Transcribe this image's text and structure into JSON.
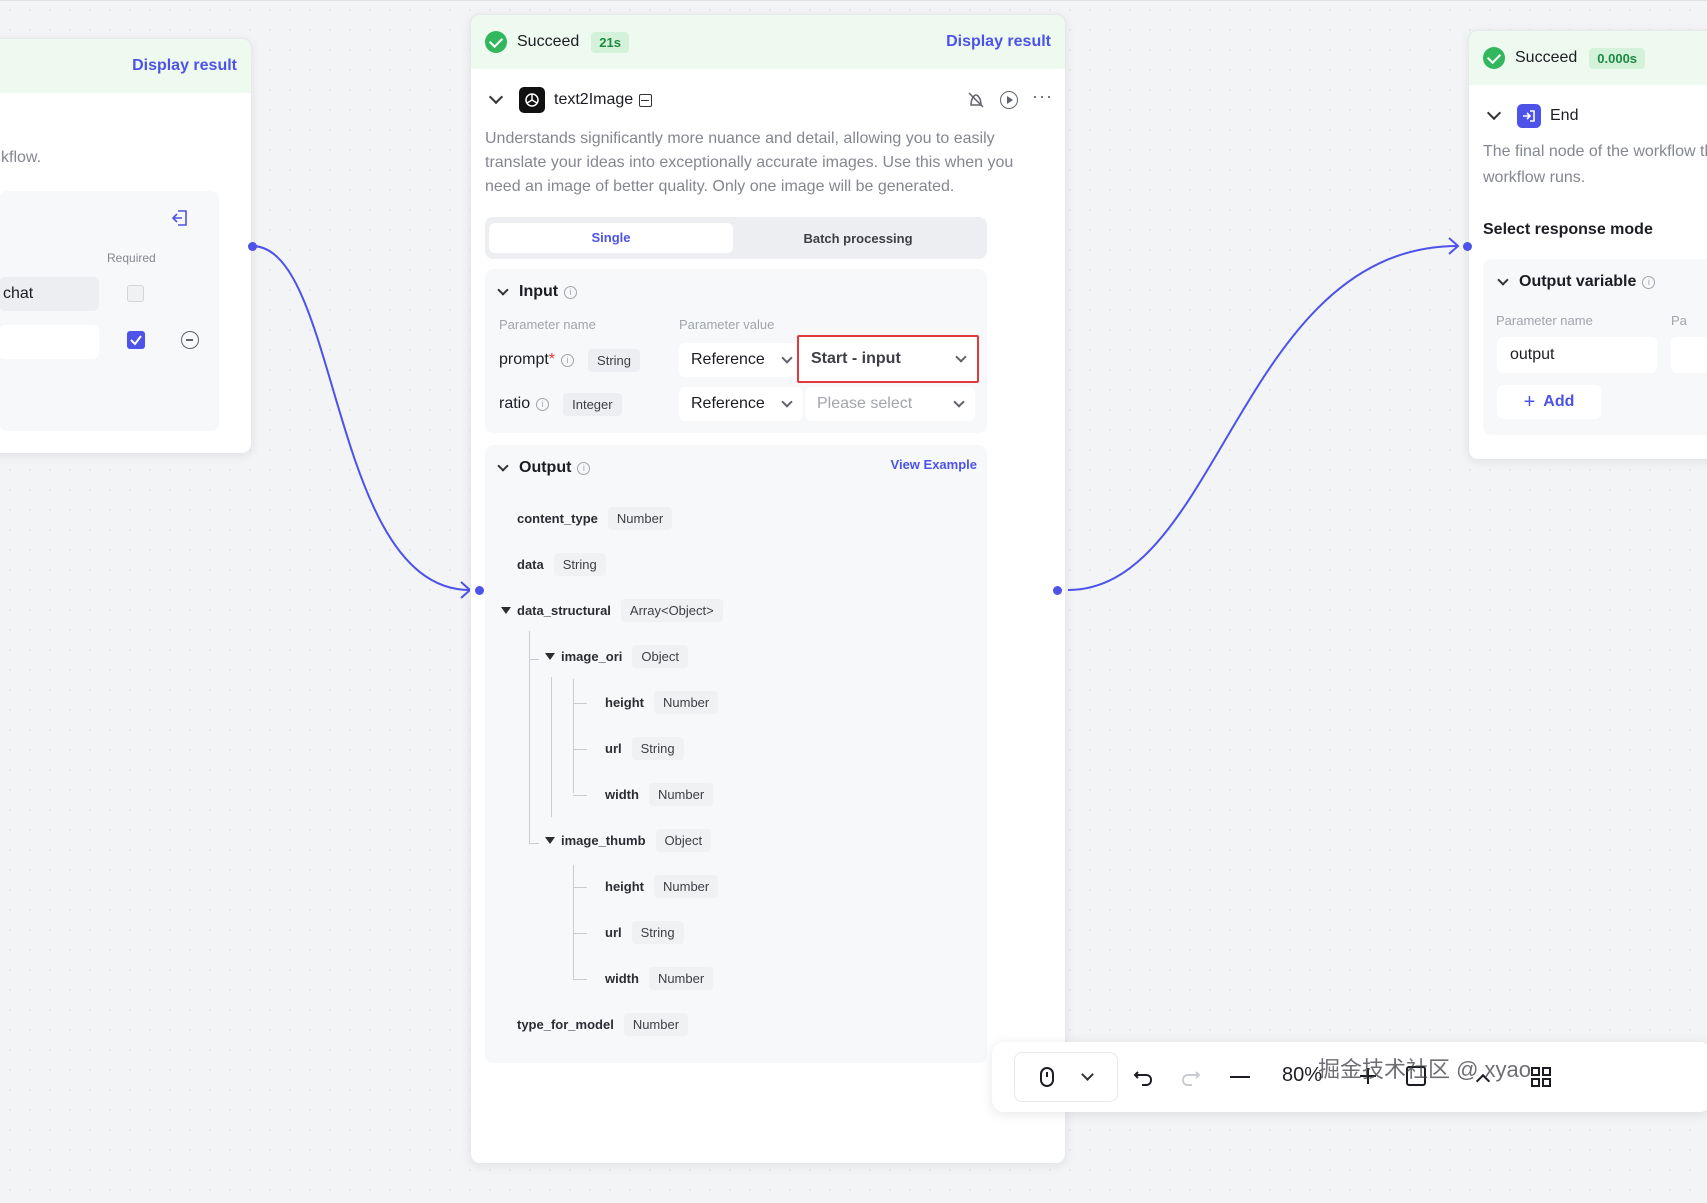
{
  "left_node": {
    "display_result": "Display result",
    "desc_tail": "kflow.",
    "required_label": "Required",
    "row1_value": "chat"
  },
  "main_node": {
    "status": "Succeed",
    "time": "21s",
    "display_result": "Display result",
    "title": "text2Image",
    "description": "Understands significantly more nuance and detail, allowing you to easily translate your ideas into exceptionally accurate images. Use this when you need an image of better quality. Only one image will be generated.",
    "tabs": [
      "Single",
      "Batch processing"
    ],
    "input": {
      "heading": "Input",
      "col_name": "Parameter name",
      "col_value": "Parameter value",
      "params": [
        {
          "name": "prompt",
          "required_mark": "*",
          "type": "String",
          "mode": "Reference",
          "value": "Start - input"
        },
        {
          "name": "ratio",
          "required_mark": "",
          "type": "Integer",
          "mode": "Reference",
          "value": "Please select"
        }
      ]
    },
    "output": {
      "heading": "Output",
      "view_example": "View Example",
      "fields": [
        {
          "name": "content_type",
          "type": "Number"
        },
        {
          "name": "data",
          "type": "String"
        },
        {
          "name": "data_structural",
          "type": "Array<Object>"
        },
        {
          "name": "image_ori",
          "type": "Object"
        },
        {
          "name": "height",
          "type": "Number"
        },
        {
          "name": "url",
          "type": "String"
        },
        {
          "name": "width",
          "type": "Number"
        },
        {
          "name": "image_thumb",
          "type": "Object"
        },
        {
          "name": "height",
          "type": "Number"
        },
        {
          "name": "url",
          "type": "String"
        },
        {
          "name": "width",
          "type": "Number"
        },
        {
          "name": "type_for_model",
          "type": "Number"
        }
      ]
    }
  },
  "end_node": {
    "status": "Succeed",
    "time": "0.000s",
    "title": "End",
    "description": "The final node of the workflow the workflow runs.",
    "response_mode_label": "Select response mode",
    "output_variable_heading": "Output variable",
    "col_name": "Parameter name",
    "col_value_partial": "Pa",
    "output_name": "output",
    "add_label": "Add"
  },
  "toolbar": {
    "zoom": "80%",
    "watermark": "掘金技术社区 @ xyao"
  },
  "colors": {
    "accent": "#4d53e8",
    "success": "#32b65e",
    "success_bg": "#eefaf0",
    "highlight_border": "#e0393e"
  }
}
